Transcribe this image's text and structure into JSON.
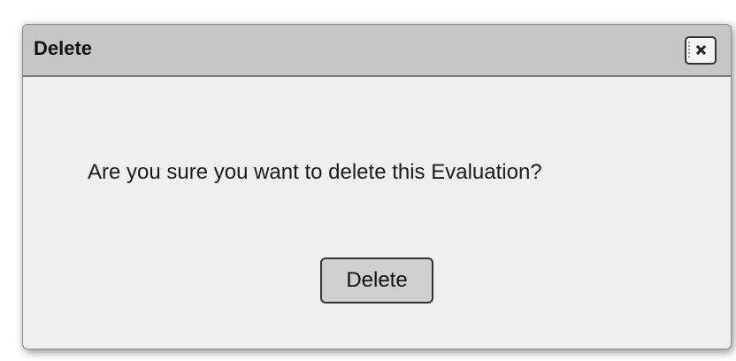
{
  "dialog": {
    "title": "Delete",
    "message": "Are you sure you want to delete this Evaluation?",
    "close_icon": "close-icon",
    "delete_button_label": "Delete"
  }
}
